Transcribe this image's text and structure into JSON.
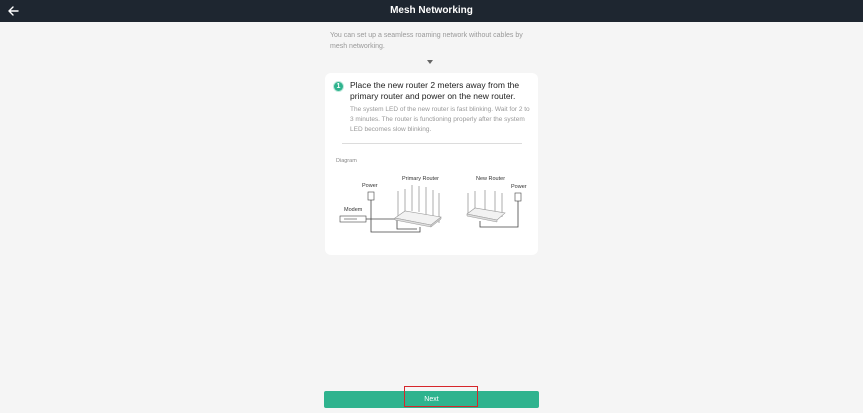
{
  "header": {
    "title": "Mesh Networking",
    "back_icon": "arrow-left-icon"
  },
  "intro": {
    "text": "You can set up a seamless roaming network without cables by mesh networking."
  },
  "step": {
    "number": "1",
    "title": "Place the new router 2 meters away from the primary router and power on the new router.",
    "description": "The system LED of the new router is fast blinking. Wait for 2 to 3 minutes. The router is functioning properly after the system LED becomes slow blinking."
  },
  "diagram": {
    "label": "Diagram",
    "power_left": "Power",
    "primary_router": "Primary Router",
    "modem": "Modem",
    "new_router": "New Router",
    "power_right": "Power"
  },
  "footer": {
    "next_label": "Next"
  },
  "colors": {
    "header_bg": "#1e2630",
    "accent": "#2fb38e",
    "highlight": "#d6262b",
    "page_bg": "#f5f5f5"
  }
}
